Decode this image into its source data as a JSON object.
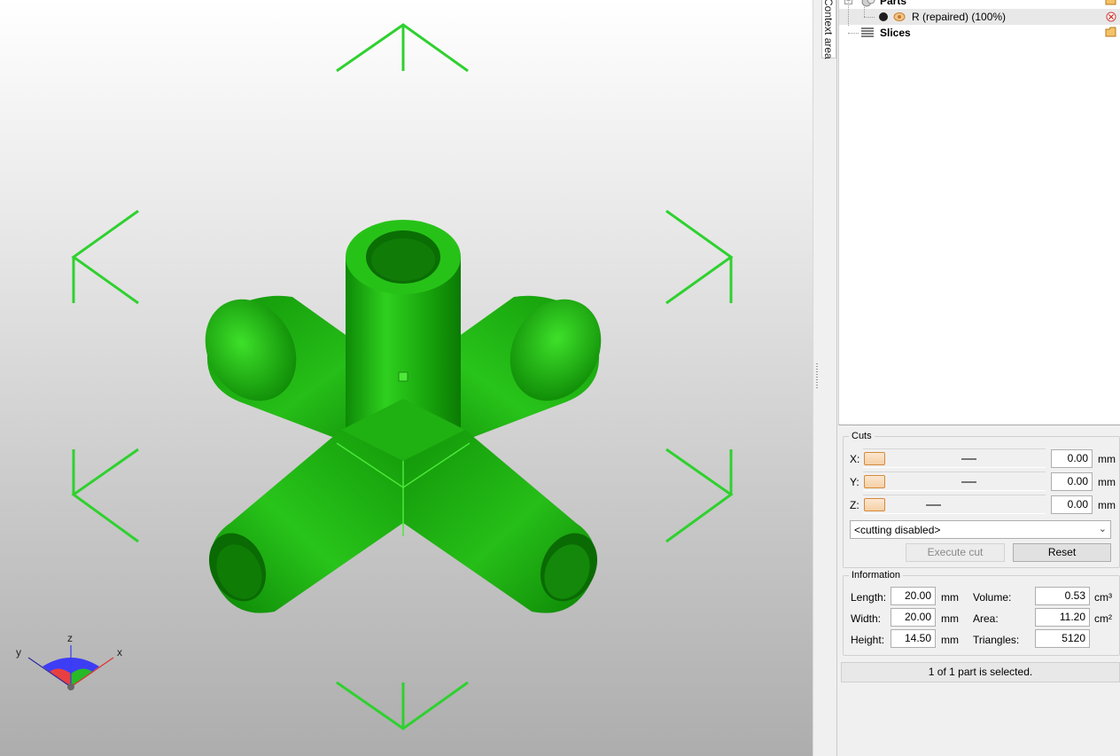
{
  "viewport": {
    "axes": {
      "x": "x",
      "y": "y",
      "z": "z"
    },
    "model_color": "#22b814",
    "bracket_color": "#2ed12e"
  },
  "context_tab": {
    "label": "Context area"
  },
  "tree": {
    "parts_label": "Parts",
    "part_name": "R (repaired) (100%)",
    "slices_label": "Slices"
  },
  "cuts": {
    "title": "Cuts",
    "axes": [
      {
        "label": "X:",
        "value": "0.00",
        "unit": "mm"
      },
      {
        "label": "Y:",
        "value": "0.00",
        "unit": "mm"
      },
      {
        "label": "Z:",
        "value": "0.00",
        "unit": "mm"
      }
    ],
    "mode_selected": "<cutting disabled>",
    "execute_label": "Execute cut",
    "reset_label": "Reset"
  },
  "info": {
    "title": "Information",
    "length_label": "Length:",
    "length_value": "20.00",
    "length_unit": "mm",
    "width_label": "Width:",
    "width_value": "20.00",
    "width_unit": "mm",
    "height_label": "Height:",
    "height_value": "14.50",
    "height_unit": "mm",
    "volume_label": "Volume:",
    "volume_value": "0.53",
    "volume_unit": "cm³",
    "area_label": "Area:",
    "area_value": "11.20",
    "area_unit": "cm²",
    "triangles_label": "Triangles:",
    "triangles_value": "5120"
  },
  "status": {
    "text": "1 of 1 part is selected."
  }
}
